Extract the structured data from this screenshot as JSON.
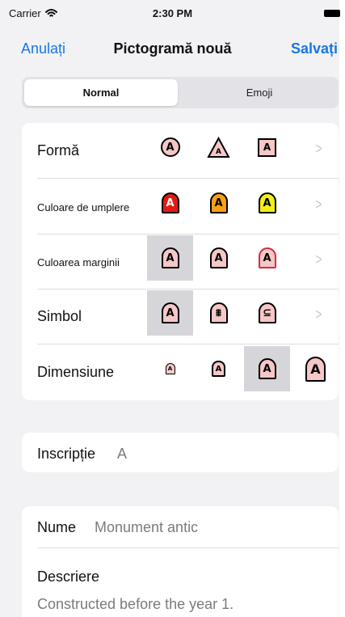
{
  "status_bar": {
    "carrier": "Carrier",
    "time": "2:30 PM",
    "wifi_icon": "wifi-icon",
    "battery_icon": "battery-icon"
  },
  "navigation": {
    "cancel": "Anulați",
    "title": "Pictogramă nouă",
    "save": "Salvați"
  },
  "tabs": {
    "normal": "Normal",
    "emoji": "Emoji",
    "selected": "Normal"
  },
  "settings": {
    "shape": {
      "label": "Formă",
      "options": [
        "A",
        "A",
        "A"
      ],
      "icons": [
        "circle-a-icon",
        "triangle-a-icon",
        "square-a-icon"
      ]
    },
    "fill_color": {
      "label": "Culoare de umplere",
      "options": [
        "A",
        "A",
        "A"
      ],
      "icons": [
        "red-fill-a-icon",
        "orange-fill-a-icon",
        "yellow-fill-a-icon"
      ],
      "colors": [
        "#e11b12",
        "#f7a014",
        "#f2ef19"
      ]
    },
    "border_color": {
      "label": "Culoarea marginii",
      "options": [
        "A",
        "A",
        "A"
      ],
      "selected_index": 0,
      "icons": [
        "black-border-a-icon",
        "black-border-a-icon",
        "red-border-a-icon"
      ]
    },
    "symbol": {
      "label": "Simbol",
      "options": [
        "A",
        "⩩",
        "⊆"
      ],
      "selected_index": 0,
      "icons": [
        "letter-a-symbol-icon",
        "shrine-symbol-icon",
        "curved-line-symbol-icon"
      ]
    },
    "size": {
      "label": "Dimensiune",
      "options": [
        "A",
        "A",
        "A",
        "A"
      ],
      "selected_index": 2,
      "icons": [
        "tiny-a-icon",
        "small-a-icon",
        "medium-a-icon",
        "large-a-icon"
      ]
    }
  },
  "inscription": {
    "label": "Inscripție",
    "value": "A"
  },
  "details": {
    "name_label": "Nume",
    "name_value": "Monument antic",
    "description_label": "Descriere",
    "description_value": "Constructed before the year 1."
  },
  "chevron": ">",
  "colors": {
    "accent": "#1677e8",
    "background": "#f2f2f4",
    "selected_option": "#d6d6da",
    "pink_fill": "#f5c7c7"
  }
}
